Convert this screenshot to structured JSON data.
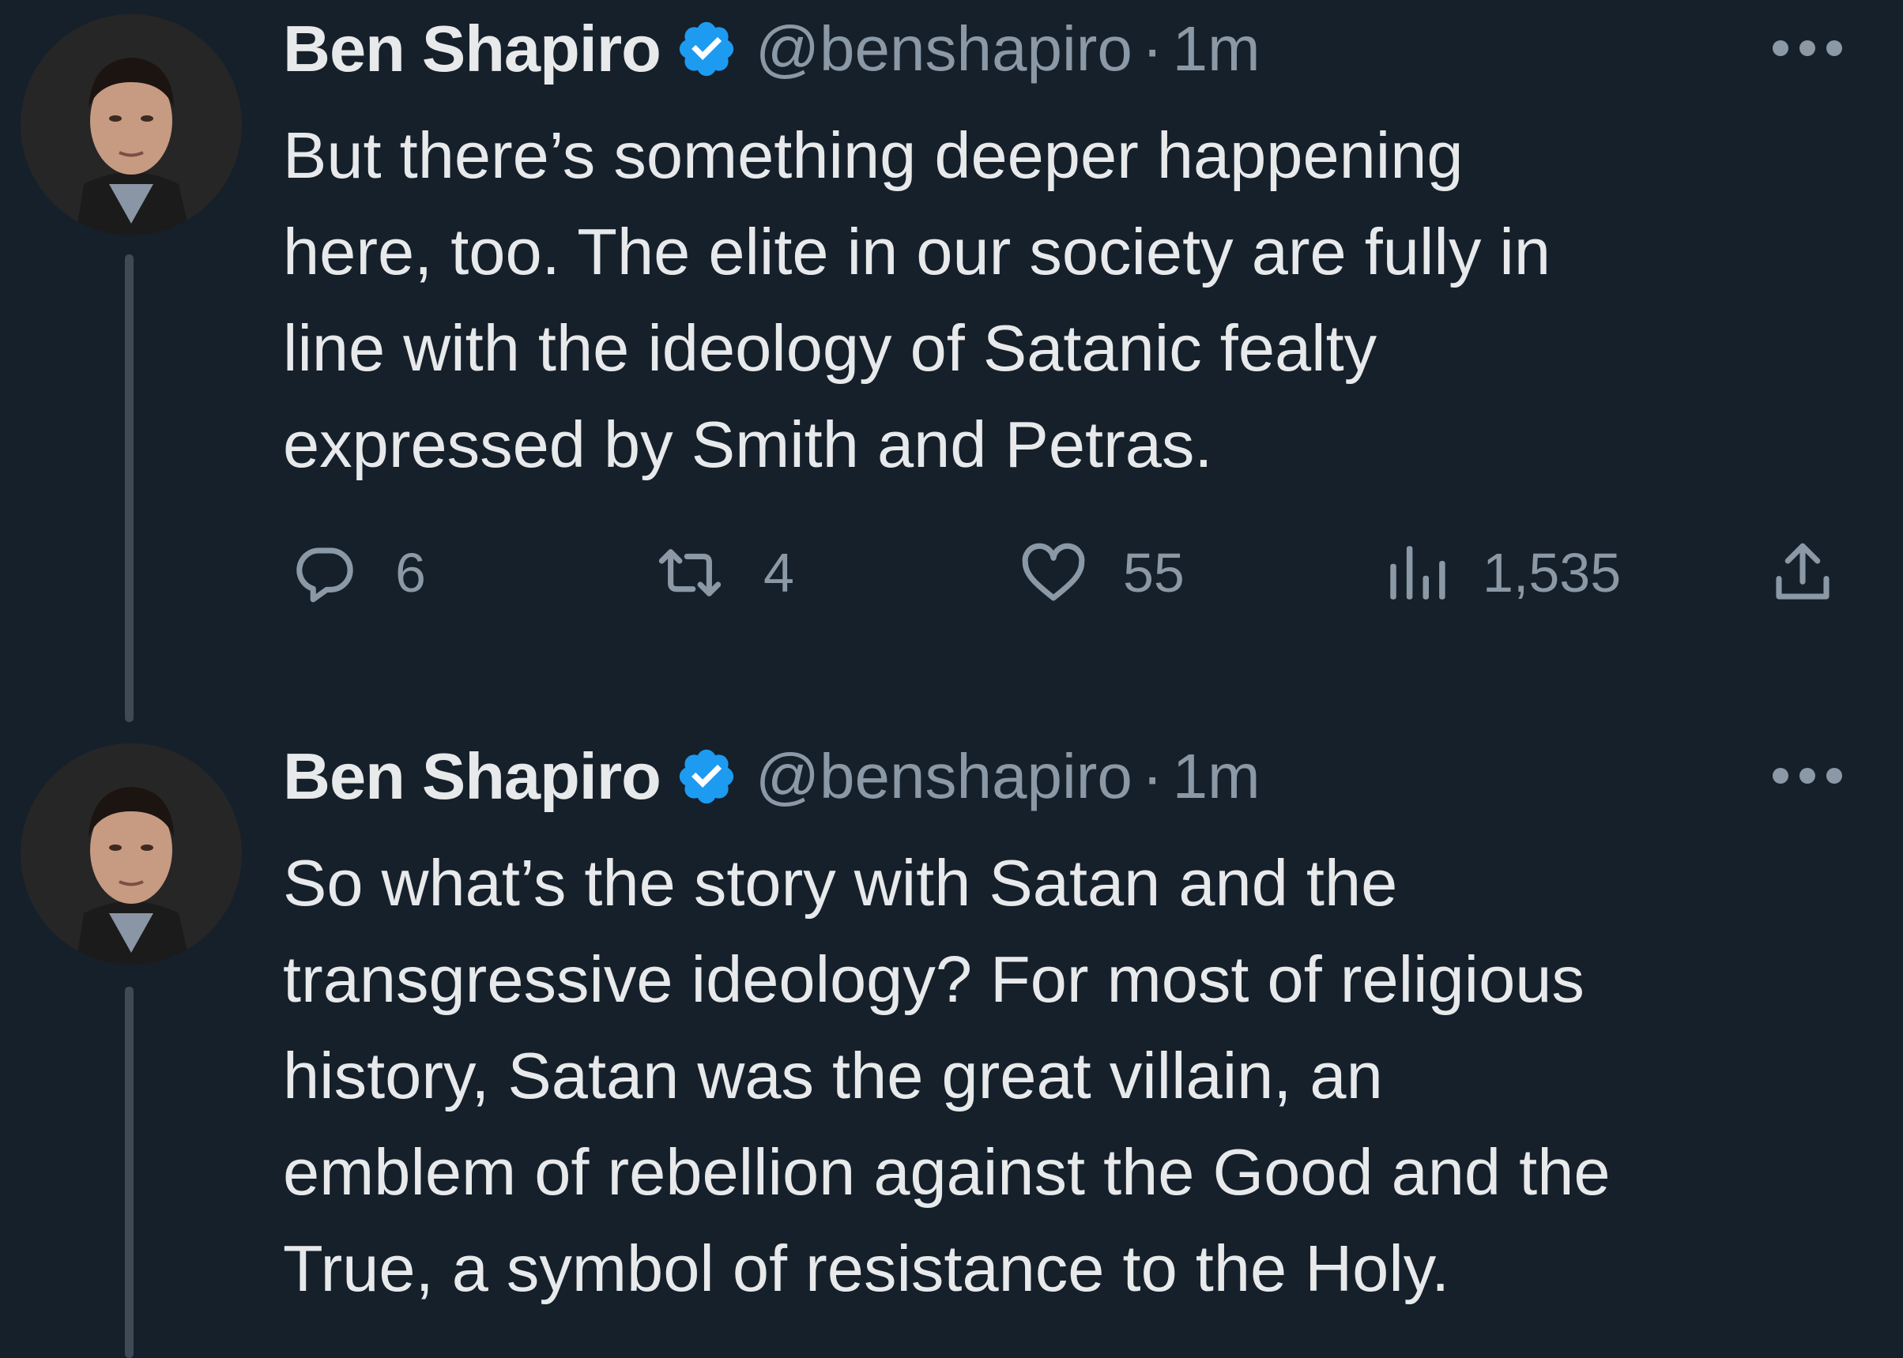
{
  "colors": {
    "background": "#15202b",
    "primary_text": "#e7e9ea",
    "secondary_text": "#8b98a5",
    "verified_badge": "#1d9bf0",
    "thread_line": "#3e4a55"
  },
  "tweets": [
    {
      "author": {
        "name": "Ben Shapiro",
        "handle": "@benshapiro",
        "verified_icon": "verified-badge-icon",
        "avatar_icon": "profile-photo"
      },
      "separator": "·",
      "time": "1m",
      "text_lines": [
        "But there’s something deeper happening",
        "here, too. The elite in our society are fully in",
        "line with the ideology of Satanic fealty",
        "expressed by Smith and Petras."
      ],
      "actions": {
        "reply": {
          "icon": "reply-icon",
          "count": "6"
        },
        "retweet": {
          "icon": "retweet-icon",
          "count": "4"
        },
        "like": {
          "icon": "heart-icon",
          "count": "55"
        },
        "views": {
          "icon": "analytics-icon",
          "count": "1,535"
        },
        "share": {
          "icon": "share-icon"
        }
      },
      "more_icon": "more-icon"
    },
    {
      "author": {
        "name": "Ben Shapiro",
        "handle": "@benshapiro",
        "verified_icon": "verified-badge-icon",
        "avatar_icon": "profile-photo"
      },
      "separator": "·",
      "time": "1m",
      "text_lines": [
        "So what’s the story with Satan and the",
        "transgressive ideology? For most of religious",
        "history, Satan was the great villain, an",
        "emblem of rebellion against the Good and the",
        "True, a symbol of resistance to the Holy."
      ],
      "more_icon": "more-icon"
    }
  ]
}
